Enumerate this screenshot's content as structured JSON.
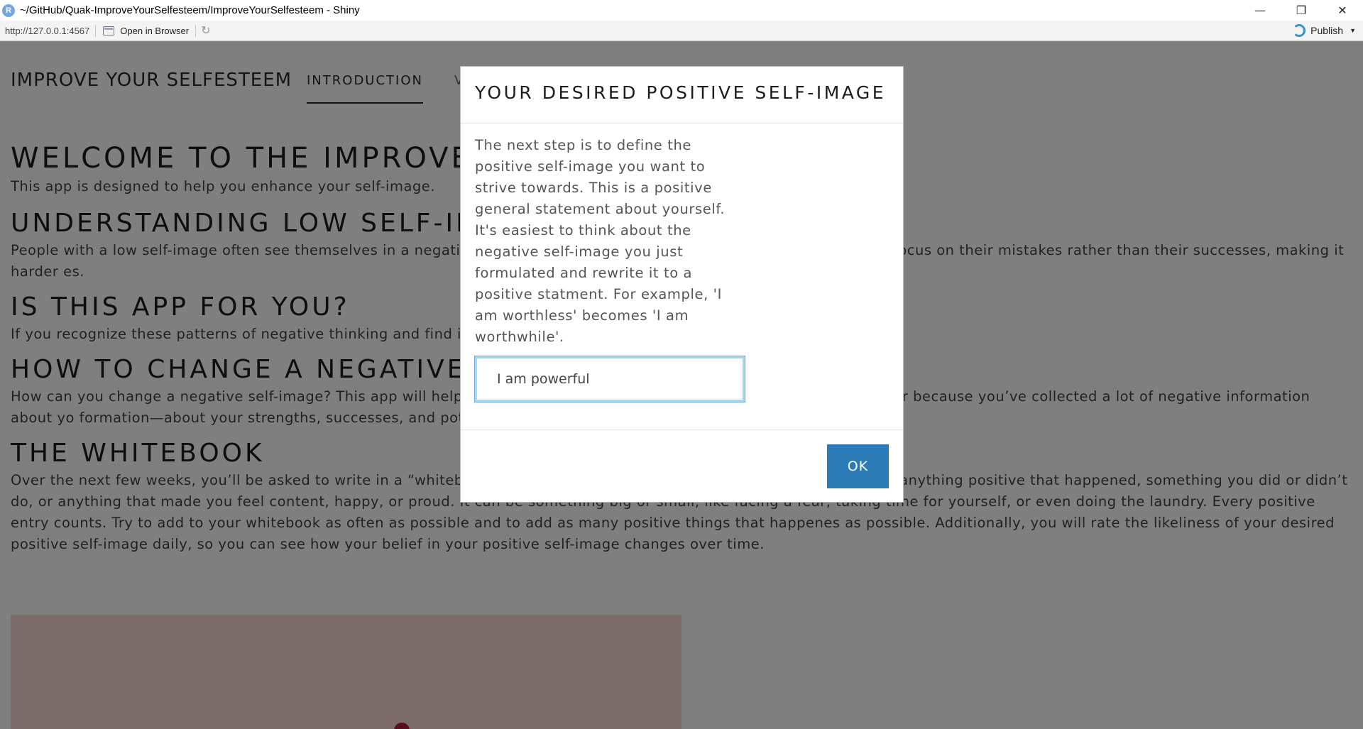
{
  "window": {
    "app_icon": "R",
    "title": "~/GitHub/Quak-ImproveYourSelfesteem/ImproveYourSelfesteem - Shiny",
    "controls": {
      "minimize": "—",
      "restore": "❐",
      "close": "✕"
    }
  },
  "toolbar": {
    "url": "http://127.0.0.1:4567",
    "open_in_browser": "Open in Browser",
    "refresh_icon": "↻",
    "publish_label": "Publish",
    "publish_caret": "▼"
  },
  "navbar": {
    "brand": "IMPROVE YOUR SELFESTEEM",
    "tabs": [
      {
        "label": "INTRODUCTION",
        "active": true
      },
      {
        "label": "V",
        "active": false
      }
    ]
  },
  "content": {
    "welcome_heading": "WELCOME TO THE IMPROVE",
    "intro_text": "This app is designed to help you enhance your self-image.",
    "sections": [
      {
        "heading": "UNDERSTANDING LOW SELF-IM",
        "text": "People with a low self-image often see themselves in a negativ enough” or “I’ll never succeed.” As a result, they tend to focus on their mistakes rather than their successes, making it harder es."
      },
      {
        "heading": "IS THIS APP FOR YOU?",
        "text": "If you recognize these patterns of negative thinking and find it you."
      },
      {
        "heading": "HOW TO CHANGE A NEGATIVE S",
        "text": "How can you change a negative self-image? This app will help self-image as a scale. Currently, the negative side is heavier because you’ve collected a lot of negative information about yo formation—about your strengths, successes, and potential."
      },
      {
        "heading": "THE WHITEBOOK",
        "text": "Over the next few weeks, you’ll be asked to write in a “whitebook,” a book filled with positive facts. Each day, note down anything positive that happened, something you did or didn’t do, or anything that made you feel content, happy, or proud. It can be something big or small, like facing a fear, taking time for yourself, or even doing the laundry. Every positive entry counts. Try to add to your whitebook as often as possible and to add as many positive things that happenes as possible. Additionally, you will rate the likeliness of your desired positive self-image daily, so you can see how your belief in your positive self-image changes over time."
      }
    ]
  },
  "modal": {
    "title": "YOUR DESIRED POSITIVE SELF-IMAGE",
    "body_text": "The next step is to define the positive self-image you want to strive towards. This is a positive general statement about yourself. It's easiest to think about the negative self-image you just formulated and rewrite it to a positive statment. For example, 'I am worthless' becomes 'I am worthwhile'.",
    "input_value": "I am powerful",
    "ok_label": "OK"
  },
  "colors": {
    "primary_button": "#2b7bb9",
    "backdrop": "#808080",
    "input_focus": "#66afe9",
    "hero_background": "#f7d7d2"
  }
}
